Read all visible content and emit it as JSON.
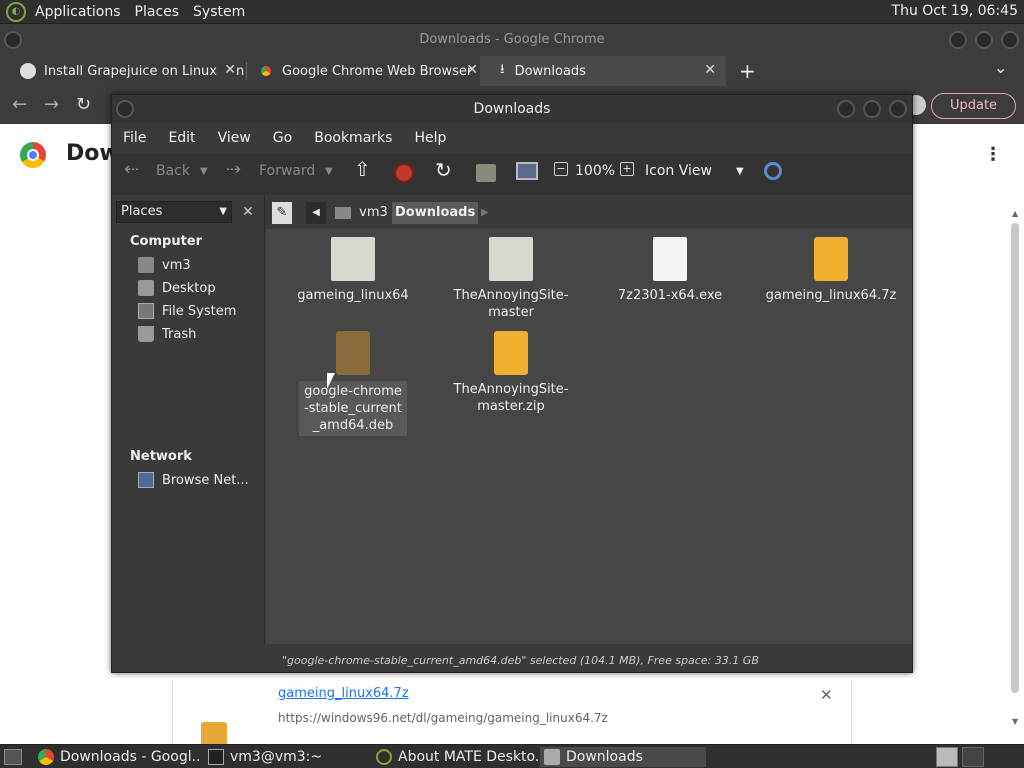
{
  "top_panel": {
    "menus": [
      "Applications",
      "Places",
      "System"
    ],
    "clock": "Thu Oct 19, 06:45"
  },
  "chrome": {
    "window_title": "Downloads - Google Chrome",
    "tabs": [
      {
        "label": "Install Grapejuice on Linux Mint",
        "icon": "web-icon"
      },
      {
        "label": "Google Chrome Web Browser",
        "icon": "chrome-icon"
      },
      {
        "label": "Downloads",
        "icon": "download-icon"
      }
    ],
    "new_tab": "+",
    "tab_menu": "⌄",
    "update_label": "Update",
    "page_title": "Dow",
    "download": {
      "filename": "gameing_linux64.7z",
      "url": "https://windows96.net/dl/gameing/gameing_linux64.7z",
      "close": "✕"
    }
  },
  "caja": {
    "title": "Downloads",
    "menu": [
      "File",
      "Edit",
      "View",
      "Go",
      "Bookmarks",
      "Help"
    ],
    "toolbar": {
      "back": "Back",
      "forward": "Forward",
      "zoom": "100%",
      "view_mode": "Icon View"
    },
    "side": {
      "combo": "Places",
      "close": "✕",
      "headings": {
        "computer": "Computer",
        "network": "Network"
      },
      "items": {
        "vm3": "vm3",
        "desktop": "Desktop",
        "filesystem": "File System",
        "trash": "Trash",
        "browse": "Browse Net..."
      }
    },
    "path": {
      "parent": "vm3",
      "current": "Downloads"
    },
    "files": [
      {
        "name": "gameing_linux64",
        "type": "folder"
      },
      {
        "name": "TheAnnoyingSite-master",
        "type": "folder"
      },
      {
        "name": "7z2301-x64.exe",
        "type": "exe"
      },
      {
        "name": "gameing_linux64.7z",
        "type": "archive"
      },
      {
        "name": "google-chrome-stable_current_amd64.deb",
        "type": "deb",
        "selected": true
      },
      {
        "name": "TheAnnoyingSite-master.zip",
        "type": "archive"
      }
    ],
    "status": "\"google-chrome-stable_current_amd64.deb\" selected (104.1 MB), Free space: 33.1 GB"
  },
  "taskbar": {
    "tasks": [
      {
        "label": "Downloads - Googl...",
        "icon": "chrome-icon"
      },
      {
        "label": "vm3@vm3:~",
        "icon": "terminal-icon"
      },
      {
        "label": "About MATE Deskto...",
        "icon": "mate-icon"
      },
      {
        "label": "Downloads",
        "icon": "folder-icon",
        "active": true
      }
    ]
  },
  "colors": {
    "panel": "#2f2f2f",
    "window_dark": "#3b3b3b",
    "chrome_frame": "#3c3c3c",
    "update_accent": "#f2b8b5",
    "link": "#1a73e8"
  }
}
